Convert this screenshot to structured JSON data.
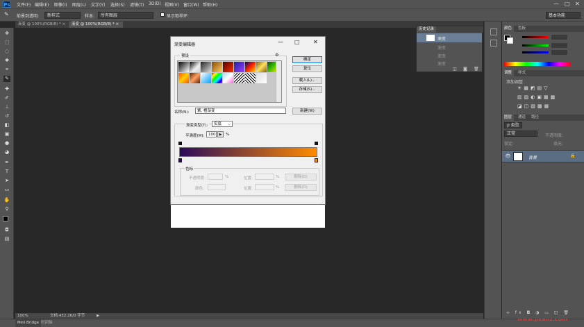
{
  "app": {
    "logo": "Ps"
  },
  "menus": [
    "文件(F)",
    "编辑(E)",
    "图像(I)",
    "图层(L)",
    "文字(Y)",
    "选择(S)",
    "滤镜(T)",
    "3D(D)",
    "视图(V)",
    "窗口(W)",
    "帮助(H)"
  ],
  "window_controls": {
    "minimize": "—",
    "restore": "□",
    "close": "✕"
  },
  "options_bar": {
    "mode_label": "前景到透明:",
    "mode_value": "所有图层",
    "preset_label": "新样式",
    "sample_label": "样本:",
    "checkbox_label": "显示取样环",
    "workspace": "基本功能"
  },
  "doc_tabs": [
    {
      "label": "渐变 @ 100%(RGB/8) *"
    },
    {
      "label": "渐变 @ 100%(RGB/8) *"
    }
  ],
  "status": {
    "zoom": "100%",
    "doc": "文档:452.2K/0 字节"
  },
  "bottom": {
    "mini_bridge": "Mini Bridge",
    "timeline": "时间轴"
  },
  "watermark": "www.psahz.com",
  "history": {
    "tab": "历史记录",
    "items": [
      "渐变",
      "渐变",
      "渐变",
      "渐变"
    ]
  },
  "panels": {
    "color_tabs": [
      "颜色",
      "色板"
    ],
    "adjust_tabs": [
      "调整",
      "样式"
    ],
    "adjust_label": "添加调整",
    "layer_tabs": [
      "图层",
      "通道",
      "路径"
    ],
    "layer_kind": "ρ 类型",
    "blend_mode": "正常",
    "opacity_label": "不透明度:",
    "lock_label": "锁定:",
    "fill_label": "填充:",
    "layer_name": "背景"
  },
  "dialog": {
    "title": "渐变编辑器",
    "presets_label": "预设",
    "ok": "确定",
    "reset": "复位",
    "load": "载入(L)...",
    "save": "存储(S)...",
    "name_label": "名称(N):",
    "name_value": "紫, 橙渐变",
    "new_btn": "新建(W)",
    "type_label": "渐变类型(T):",
    "type_value": "实底",
    "smooth_label": "平滑度(M):",
    "smooth_value": "100",
    "smooth_unit": "%",
    "stops_label": "色标",
    "opacity_label": "不透明度:",
    "color_label": "颜色:",
    "location_label": "位置:",
    "delete_label": "删除(D)",
    "pct": "%",
    "gradient_colors": [
      "#2a0a5a",
      "#ff8c00"
    ]
  }
}
